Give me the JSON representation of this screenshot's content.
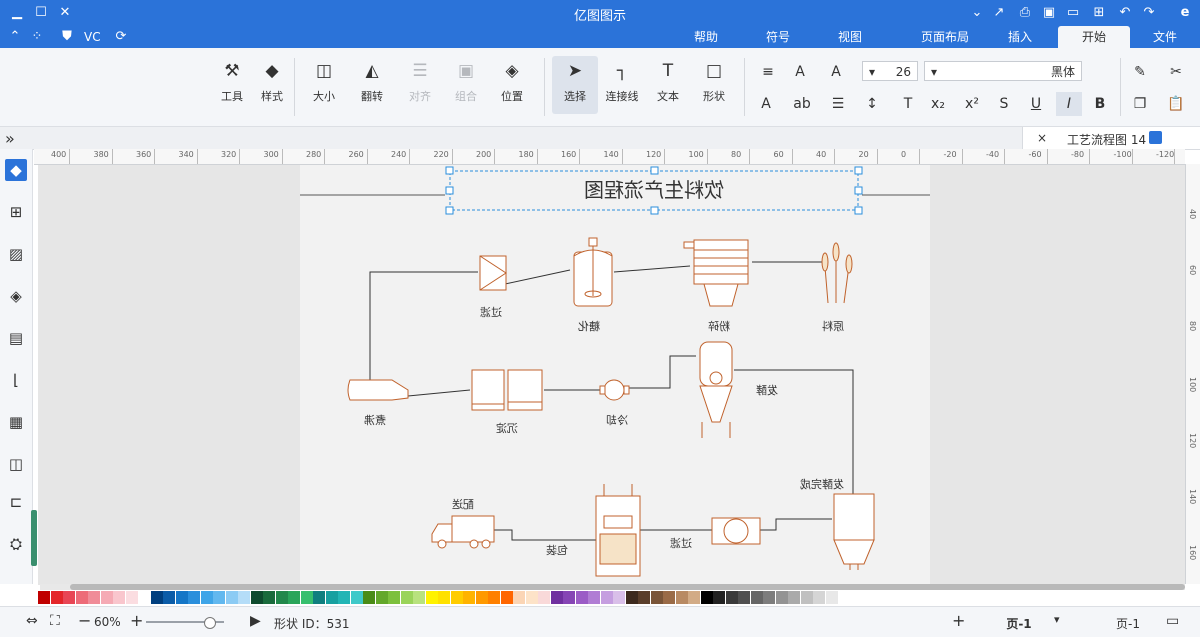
{
  "window": {
    "title": "亿图图示",
    "brand_colors": {
      "titlebar": "#2b73d9",
      "ribbon": "#f4f6f9",
      "accent": "#c0622c"
    }
  },
  "titlebar_icons": [
    "menu-icon",
    "undo-icon",
    "redo-icon",
    "new-icon",
    "open-icon",
    "save-icon",
    "print-icon",
    "export-icon",
    "settings-icon",
    "help-icon"
  ],
  "menu": {
    "tabs": [
      "文件",
      "开始",
      "插入",
      "页面布局",
      "视图",
      "符号",
      "帮助"
    ],
    "active": "开始",
    "right_tools": {
      "vc": "VC"
    }
  },
  "ribbon": {
    "font_name": "黑体",
    "font_size": "26",
    "buttons": {
      "tools": "工具",
      "style": "样式",
      "size": "大小",
      "rotate": "翻转",
      "align": "对齐",
      "group": "组合",
      "position": "位置",
      "select": "选择",
      "connector": "连接线",
      "text": "文本",
      "shape": "形状"
    }
  },
  "doc_tab": {
    "name": "工艺流程图 14",
    "close": "×"
  },
  "ruler": {
    "h_labels": [
      "-120",
      "-100",
      "-80",
      "-60",
      "-40",
      "-20",
      "0",
      "20",
      "40",
      "60",
      "80",
      "100",
      "120",
      "140",
      "160",
      "180",
      "200",
      "220",
      "240",
      "260",
      "280",
      "300",
      "320",
      "340",
      "360",
      "380",
      "400"
    ],
    "v_labels": [
      "40",
      "60",
      "80",
      "100",
      "120",
      "140",
      "160"
    ]
  },
  "diagram": {
    "title": "饮料生产流程图",
    "nodes": {
      "raw": "原料",
      "crush": "粉碎",
      "saccharify": "糖化",
      "filter1": "过滤",
      "boil": "煮沸",
      "settle": "沉淀",
      "cool": "冷却",
      "ferment": "发酵",
      "ferment_done": "发酵完成",
      "filter2": "过滤",
      "pack": "包装",
      "deliver": "配送"
    }
  },
  "palette": [
    "#c00000",
    "#e4262a",
    "#e84655",
    "#ed6b78",
    "#f08c98",
    "#f5aab4",
    "#f9c6cd",
    "#fbdde1",
    "#ffffff",
    "#003f7f",
    "#0b5ca8",
    "#1576c7",
    "#2b8fdc",
    "#3fa5e8",
    "#62b8ef",
    "#8ccbf4",
    "#b5ddf8",
    "#0f4b2e",
    "#1a6b3c",
    "#22884b",
    "#2aa55a",
    "#36bf6e",
    "#0f7f7f",
    "#17a0a0",
    "#22b5b5",
    "#3fc9c9",
    "#4a8c17",
    "#63a82b",
    "#7cc03d",
    "#9ad45a",
    "#b8e27e",
    "#fff200",
    "#ffe100",
    "#ffcc00",
    "#ffb300",
    "#ff9900",
    "#ff8000",
    "#ff6600",
    "#fbd5b5",
    "#fde3c8",
    "#f9d9d9",
    "#7030a0",
    "#8645b5",
    "#9b5cc6",
    "#b07dd4",
    "#c59ee0",
    "#d9bfe9",
    "#3d2a1e",
    "#5a3e2b",
    "#7a5538",
    "#9a6b47",
    "#b88a63",
    "#d2ab86",
    "#000000",
    "#222222",
    "#3a3a3a",
    "#505050",
    "#666666",
    "#7d7d7d",
    "#939393",
    "#aaaaaa",
    "#c0c0c0",
    "#d5d5d5",
    "#e8e8e8"
  ],
  "status": {
    "page_select": "页-1",
    "page_tab": "页-1",
    "shape_id": "形状 ID：531",
    "zoom": "60%"
  }
}
